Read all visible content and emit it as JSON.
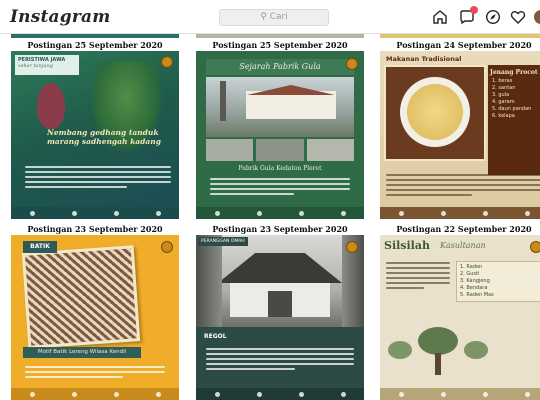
{
  "header": {
    "logo": "Instagram",
    "search_placeholder": "Cari",
    "icons": [
      "home-icon",
      "messages-icon",
      "explore-icon",
      "heart-icon",
      "profile-icon"
    ]
  },
  "posts": [
    {
      "caption": "Postingan 25 September 2020",
      "banner": "PERISTIWA JAWA",
      "banner_sub": "sekar tanjung",
      "headline": "Nembang gedhang tanduk marang sadhengah kadang",
      "colors": {
        "bg": "#1f6b6e",
        "accent": "#e2a84a"
      }
    },
    {
      "caption": "Postingan 25 September 2020",
      "title": "Sejarah Pabrik Gula",
      "subtitle": "Pabrik Gula Kedaton Pleret",
      "colors": {
        "bg": "#2f6b46"
      }
    },
    {
      "caption": "Postingan 24 September 2020",
      "title": "Makanan Tradisional",
      "side_title": "Jenang Procot",
      "ingredients": [
        "1. beras",
        "2. santan",
        "3. gula",
        "4. garam",
        "5. daun pandan",
        "6. kelapa"
      ],
      "colors": {
        "bg": "#e5d8b6"
      }
    },
    {
      "caption": "Postingan 23 September 2020",
      "tag": "BATIK",
      "label": "Motif Batik Lereng Wilasa Kendil",
      "colors": {
        "bg": "#efad2a"
      }
    },
    {
      "caption": "Postingan 23 September 2020",
      "tag": "PERANGGAN OMAH",
      "label": "REGOL",
      "colors": {
        "bg": "#2c4a46"
      }
    },
    {
      "caption": "Postingan 22 September 2020",
      "title": "Silsilah",
      "title_script": "Kasultanan",
      "list": [
        "1. Raden",
        "2. Gusti",
        "3. Kangjeng",
        "4. Bendara",
        "5. Raden Mas"
      ],
      "colors": {
        "bg": "#e9e1cb"
      }
    }
  ]
}
